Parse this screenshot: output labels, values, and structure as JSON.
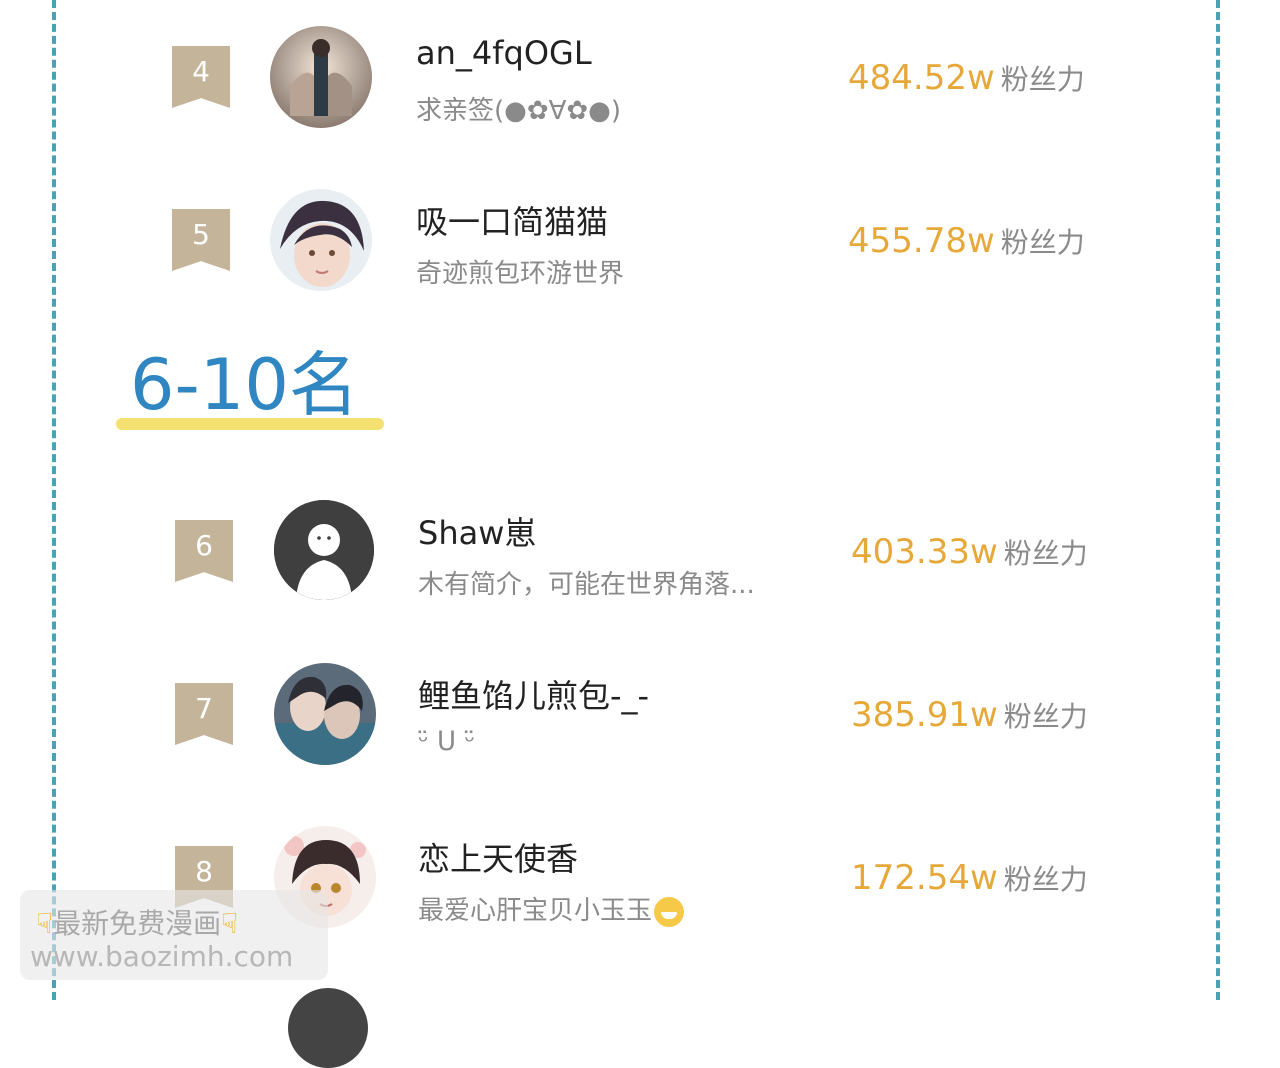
{
  "section": {
    "title": "6-10名"
  },
  "entries": [
    {
      "rank": "4",
      "name": "an_4fqOGL",
      "desc": "求亲签(●✿∀✿●)",
      "score": "484.52w",
      "unit": "粉丝力",
      "avatar": "anime-character-avatar"
    },
    {
      "rank": "5",
      "name": "吸一口简猫猫",
      "desc": "奇迹煎包环游世界",
      "score": "455.78w",
      "unit": "粉丝力",
      "avatar": "anime-character-avatar"
    },
    {
      "rank": "6",
      "name": "Shaw崽",
      "desc": "木有简介，可能在世界角落...",
      "score": "403.33w",
      "unit": "粉丝力",
      "avatar": "default-user-avatar"
    },
    {
      "rank": "7",
      "name": "鲤鱼馅儿煎包-_-",
      "desc": "ᵕ̈ ᑌ ᵕ̈",
      "score": "385.91w",
      "unit": "粉丝力",
      "avatar": "anime-character-avatar"
    },
    {
      "rank": "8",
      "name": "恋上天使香",
      "desc": "最爱心肝宝贝小玉玉",
      "score": "172.54w",
      "unit": "粉丝力",
      "avatar": "anime-character-avatar"
    }
  ],
  "watermark": {
    "line1": "最新免费漫画",
    "line2": "www.baozimh.com",
    "icon": "pointing-down-hand"
  },
  "colors": {
    "border": "#4aa3b5",
    "score": "#e7a83a",
    "rank_badge": "#c4b49a",
    "section_title": "#2f86c0",
    "underline": "#f4e071"
  }
}
